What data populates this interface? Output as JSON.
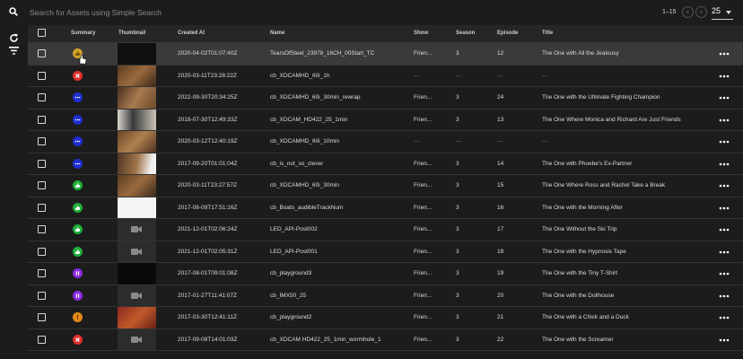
{
  "search": {
    "placeholder": "Search for Assets using Simple Search"
  },
  "pager": {
    "range": "1–15",
    "page_size": "25",
    "prev_icon": "chevron-left-icon",
    "next_icon": "chevron-right-icon"
  },
  "columns": {
    "summary": "Summary",
    "thumbnail": "Thumbnail",
    "created_at": "Created At",
    "name": "Name",
    "show": "Show",
    "season": "Season",
    "episode": "Episode",
    "title": "Title"
  },
  "colors": {
    "orange": "#d4a12a",
    "red": "#e0312f",
    "blue": "#1e2fd0",
    "green": "#1faf3a",
    "purple": "#8a2be2",
    "amber": "#e08a16"
  },
  "rows": [
    {
      "status": "orange-thumbs",
      "created": "2020-04-02T01:07:40Z",
      "name": "TearsOfSteel_23978_16CH_00Start_TC",
      "show": "Frien...",
      "season": "3",
      "episode": "12",
      "title": "The One with All the Jealousy",
      "thumb": "t1"
    },
    {
      "status": "red-x",
      "created": "2020-03-11T23:28:22Z",
      "name": "cb_XDCAMHD_60i_1h",
      "show": "---",
      "season": "---",
      "episode": "---",
      "title": "---",
      "thumb": "t2"
    },
    {
      "status": "blue-dots",
      "created": "2022-09-30T20:34:25Z",
      "name": "cb_XDCAMHD_60i_30min_rewrap",
      "show": "Frien...",
      "season": "3",
      "episode": "24",
      "title": "The One with the Ultimate Fighting Champion",
      "thumb": "t3"
    },
    {
      "status": "blue-dots",
      "created": "2018-07-30T12:49:33Z",
      "name": "cb_XDCAM_HD422_25_1min",
      "show": "Frien...",
      "season": "3",
      "episode": "13",
      "title": "The One Where Monica and Richard Are Just Friends",
      "thumb": "t4"
    },
    {
      "status": "blue-dots",
      "created": "2020-03-12T12:40:19Z",
      "name": "cb_XDCAMHD_60i_10min",
      "show": "---",
      "season": "---",
      "episode": "---",
      "title": "---",
      "thumb": "t5"
    },
    {
      "status": "blue-dots",
      "created": "2017-09-20T01:01:04Z",
      "name": "cb_is_not_so_clever",
      "show": "Frien...",
      "season": "3",
      "episode": "14",
      "title": "The One with Phoebe's Ex-Partner",
      "thumb": "t6"
    },
    {
      "status": "green-thumb",
      "created": "2020-03-11T23:27:57Z",
      "name": "cb_XDCAMHD_60i_30min",
      "show": "Frien...",
      "season": "3",
      "episode": "15",
      "title": "The One Where Ross and Rachel Take a Break",
      "thumb": "t7"
    },
    {
      "status": "green-thumb",
      "created": "2017-08-09T17:51:16Z",
      "name": "cb_Boats_audibleTrackNum",
      "show": "Frien...",
      "season": "3",
      "episode": "16",
      "title": "The One with the Morning After",
      "thumb": "t8"
    },
    {
      "status": "green-thumb",
      "created": "2021-12-01T02:06:24Z",
      "name": "LED_API-Post002",
      "show": "Frien...",
      "season": "3",
      "episode": "17",
      "title": "The One Without the Ski Trip",
      "thumb": "ph"
    },
    {
      "status": "green-thumb",
      "created": "2021-12-01T02:05:31Z",
      "name": "LED_API-Post001",
      "show": "Frien...",
      "season": "3",
      "episode": "18",
      "title": "The One with the Hypnosis Tape",
      "thumb": "ph"
    },
    {
      "status": "purple-pause",
      "created": "2017-08-01T09:01:08Z",
      "name": "cb_playground3",
      "show": "Frien...",
      "season": "3",
      "episode": "19",
      "title": "The One with the Tiny T-Shirt",
      "thumb": "t11"
    },
    {
      "status": "purple-pause",
      "created": "2017-01-27T11:41:07Z",
      "name": "cb_IMX50_25",
      "show": "Frien...",
      "season": "3",
      "episode": "20",
      "title": "The One with the Dollhouse",
      "thumb": "ph"
    },
    {
      "status": "amber-excl",
      "created": "2017-03-30T12:41:11Z",
      "name": "cb_playground2",
      "show": "Frien...",
      "season": "3",
      "episode": "21",
      "title": "The One with a Chick and a Duck",
      "thumb": "t13"
    },
    {
      "status": "red-x",
      "created": "2017-09-08T14:01:03Z",
      "name": "cb_XDCAM HD422_25_1min_wormhole_1",
      "show": "Frien...",
      "season": "3",
      "episode": "22",
      "title": "The One with the Screamer",
      "thumb": "ph"
    }
  ]
}
